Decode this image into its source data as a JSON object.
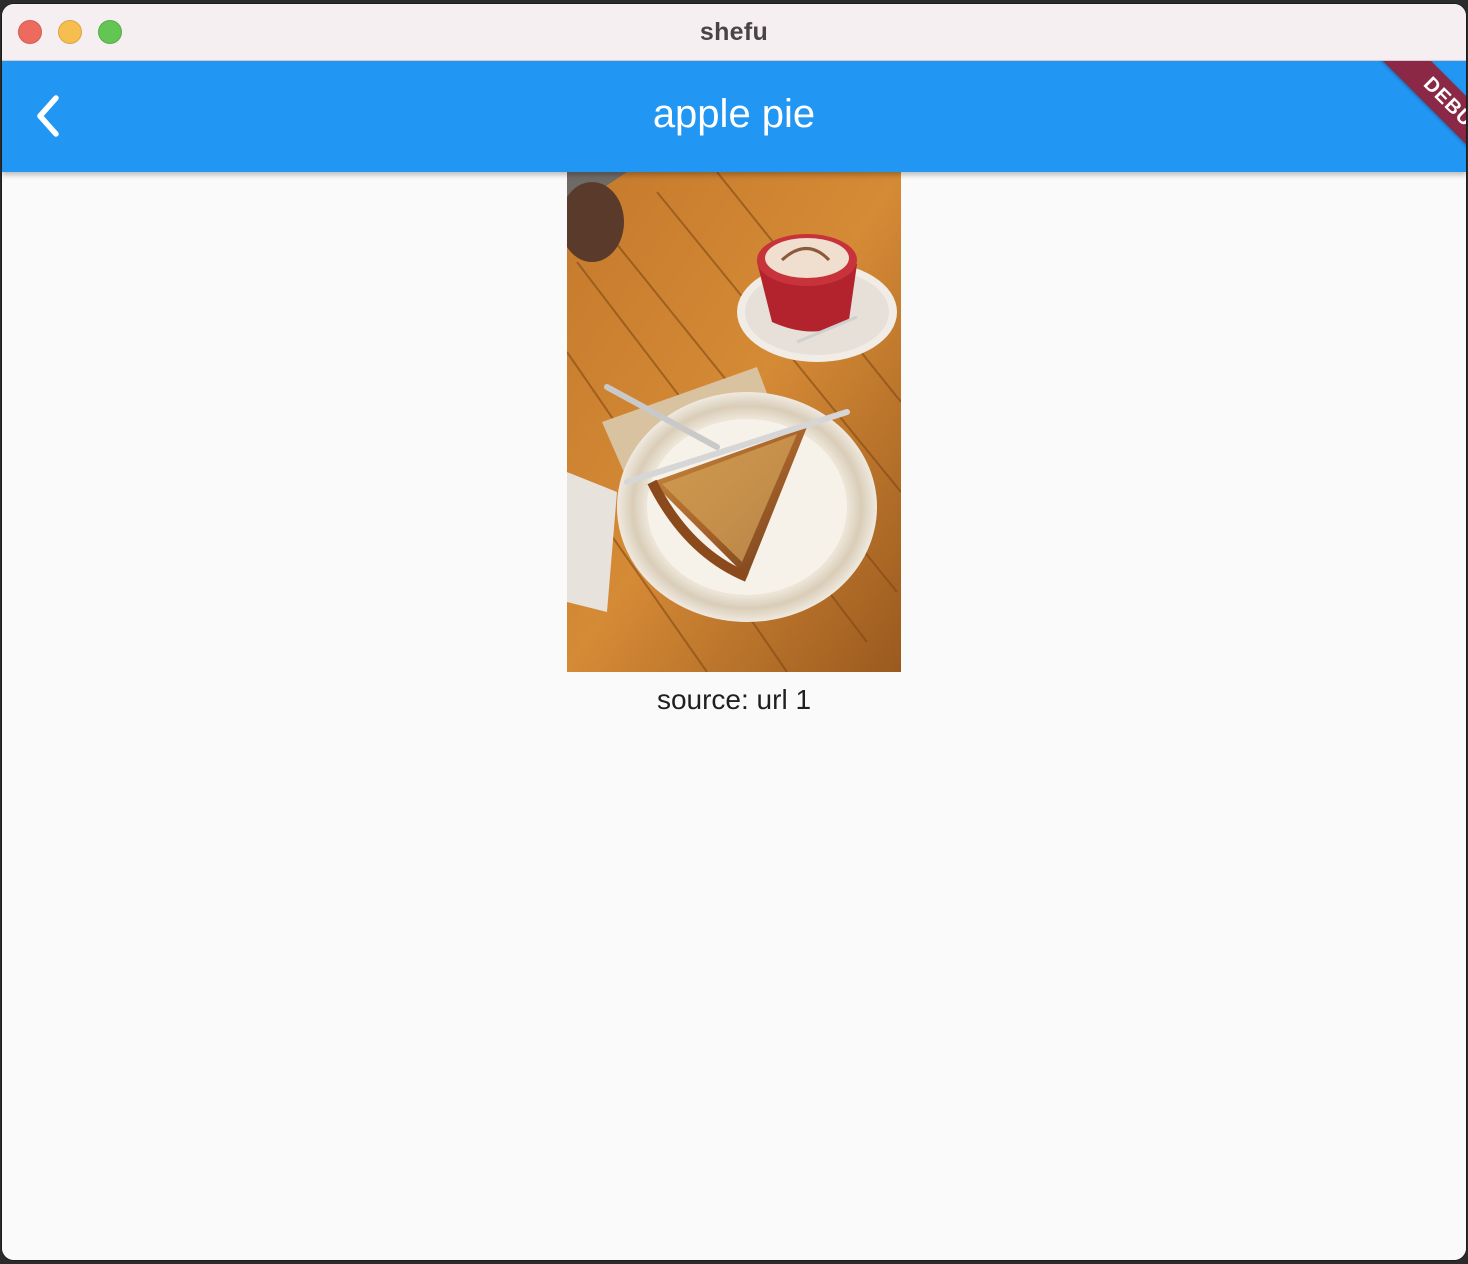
{
  "window": {
    "title": "shefu"
  },
  "appbar": {
    "title": "apple pie",
    "back_icon": "chevron-left-icon",
    "background_color": "#2196f3"
  },
  "debug_banner": {
    "label": "DEBUG",
    "color": "#8b2846"
  },
  "recipe": {
    "image": "apple-pie-photo",
    "source_text": "source: url 1"
  }
}
